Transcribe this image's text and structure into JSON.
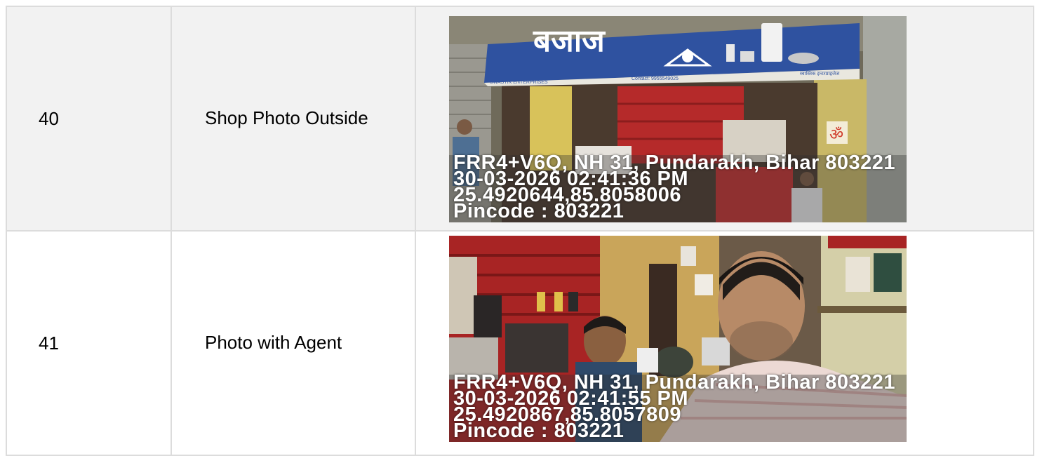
{
  "rows": [
    {
      "number": "40",
      "label": "Shop Photo Outside",
      "photo": {
        "sign_text": "बजाज",
        "sign_sub_left": "SWASTIK ENTERPRISES",
        "sign_contact": "Contact: 9955549025",
        "sign_sub_right": "स्वास्तिक इन्टरप्राइजेज",
        "stamp": {
          "address": "FRR4+V6Q, NH 31, Pundarakh, Bihar 803221",
          "datetime": "30-03-2026 02:41:36 PM",
          "coords": "25.4920644,85.8058006",
          "pincode": "Pincode : 803221"
        }
      }
    },
    {
      "number": "41",
      "label": "Photo with Agent",
      "photo": {
        "stamp": {
          "address": "FRR4+V6Q, NH 31, Pundarakh, Bihar 803221",
          "datetime": "30-03-2026 02:41:55 PM",
          "coords": "25.4920867,85.8057809",
          "pincode": "Pincode : 803221"
        }
      }
    }
  ]
}
